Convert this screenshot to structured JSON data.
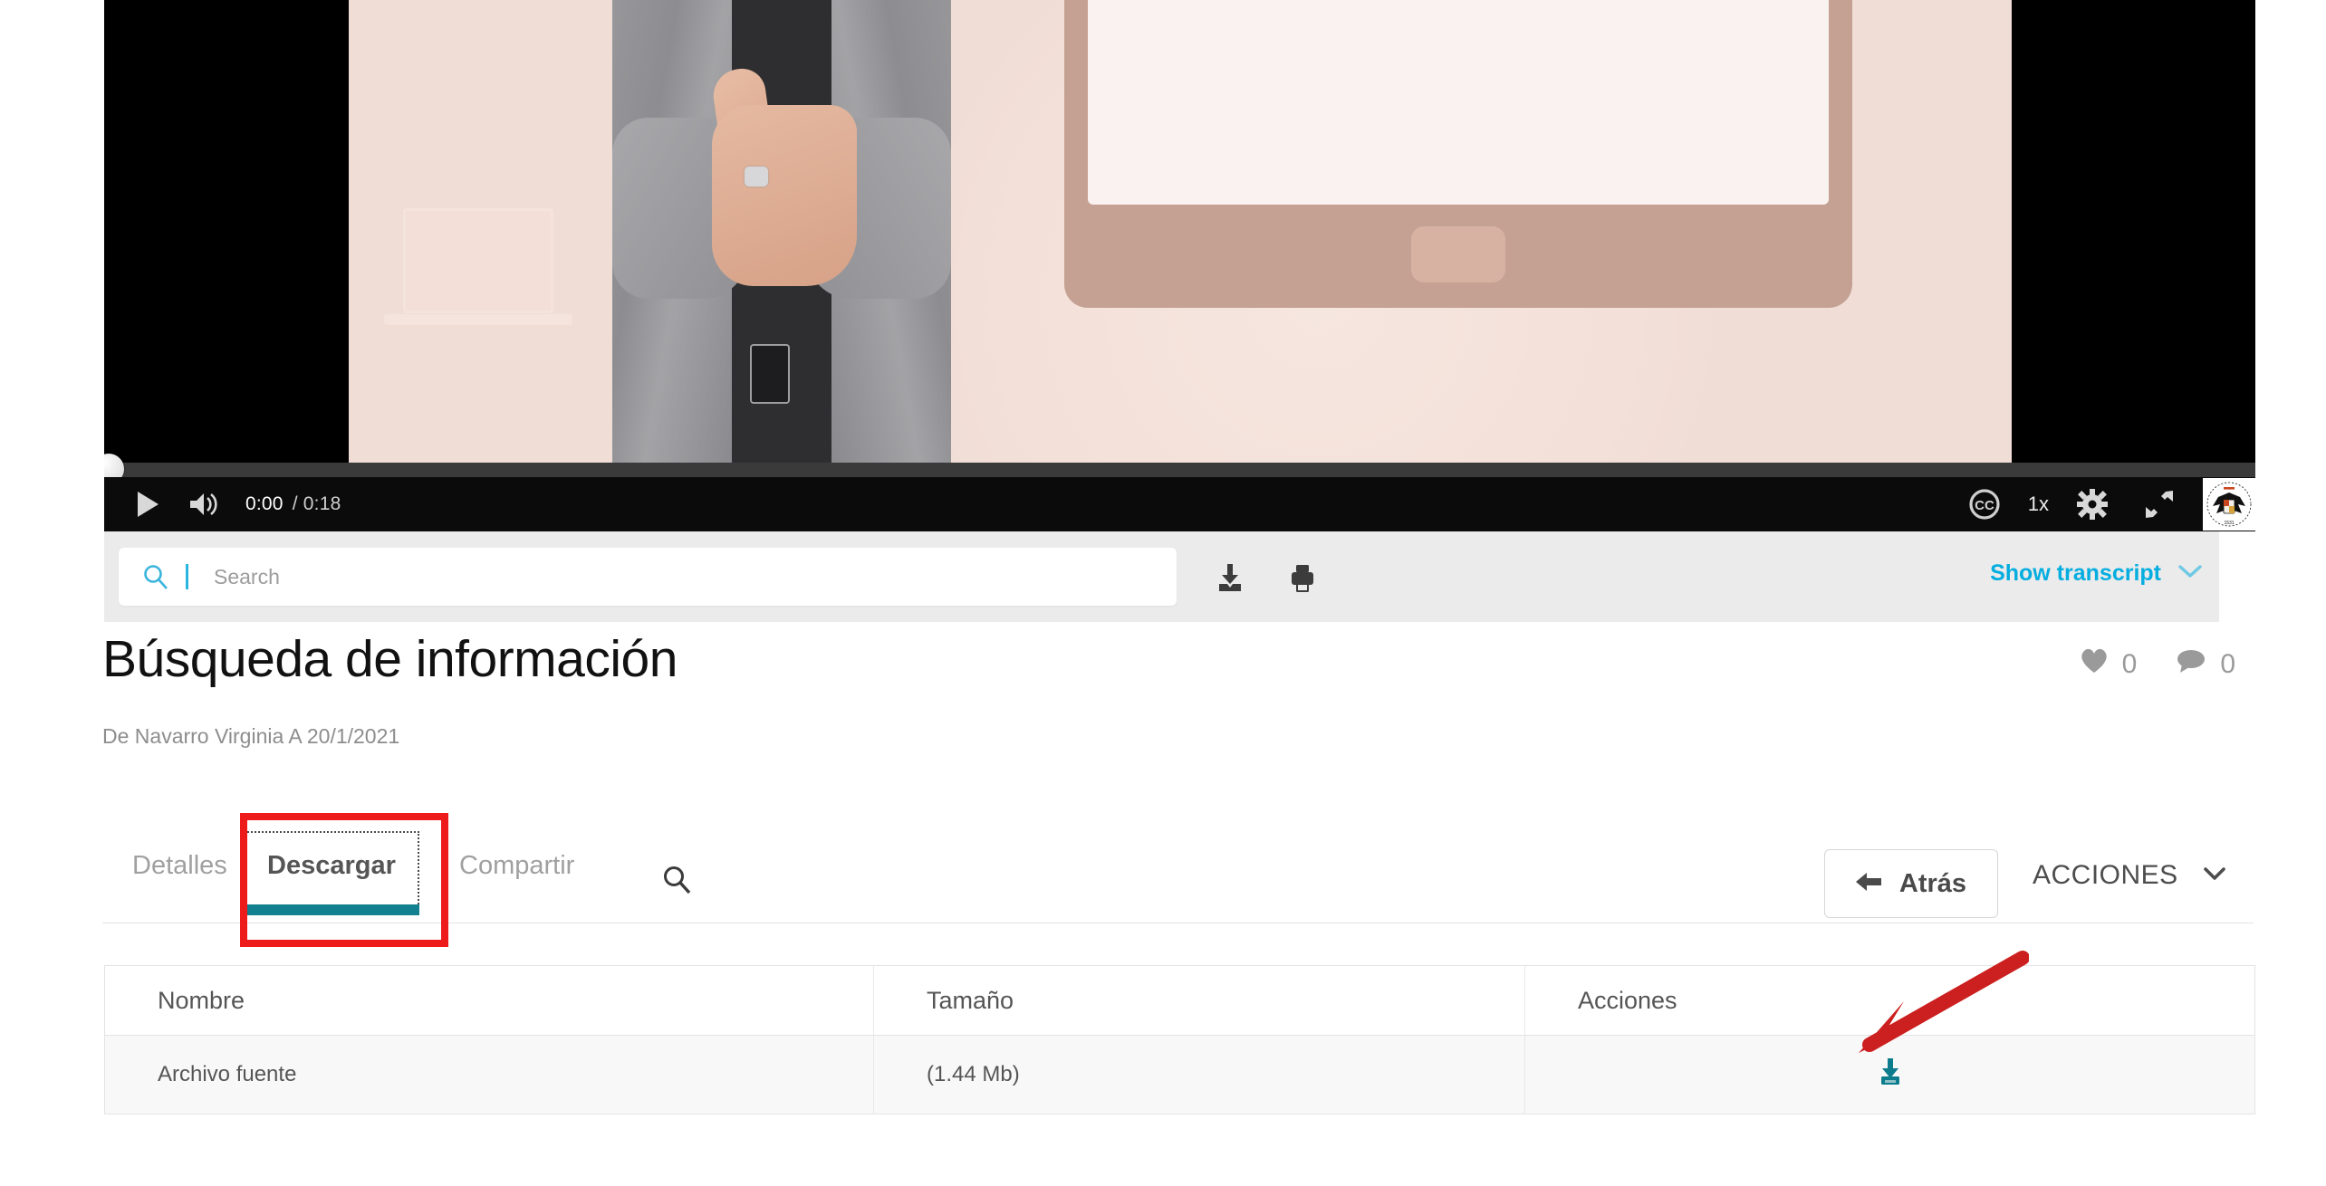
{
  "player": {
    "current_time": "0:00",
    "separator": "/",
    "total_time": "0:18",
    "speed_label": "1x",
    "progress_percent": 0,
    "icons": {
      "play": "play-icon",
      "volume": "volume-icon",
      "captions": "cc-icon",
      "settings": "gear-icon",
      "fullscreen": "fullscreen-icon",
      "logo": "university-logo"
    }
  },
  "search": {
    "placeholder": "Search",
    "value": "",
    "icons": {
      "search": "search-icon",
      "download": "download-icon",
      "print": "print-icon"
    }
  },
  "transcript": {
    "label": "Show transcript",
    "chevron": "chevron-down-icon",
    "color": "#06aee0"
  },
  "header": {
    "title": "Búsqueda de información",
    "byline": "De Navarro Virginia A 20/1/2021",
    "stats": [
      {
        "icon": "heart-icon",
        "count": "0"
      },
      {
        "icon": "comment-icon",
        "count": "0"
      }
    ]
  },
  "tabs": {
    "items": [
      {
        "label": "Detalles",
        "active": false
      },
      {
        "label": "Descargar",
        "active": true
      },
      {
        "label": "Compartir",
        "active": false
      }
    ],
    "search_icon": "search-icon",
    "active_underline_color": "#12808f",
    "highlight_color": "#ee1b1b"
  },
  "actions": {
    "back_label": "Atrás",
    "back_icon": "arrow-left-icon",
    "menu_label": "ACCIONES",
    "menu_icon": "chevron-down-icon"
  },
  "table": {
    "columns": [
      "Nombre",
      "Tamaño",
      "Acciones"
    ],
    "rows": [
      {
        "nombre": "Archivo fuente",
        "tamano": "(1.44 Mb)",
        "action_icon": "download-icon"
      }
    ],
    "action_icon_color": "#0d7c8c"
  },
  "annotations": {
    "arrow_color": "#cc1f1f",
    "box_color": "#ee1b1b"
  }
}
